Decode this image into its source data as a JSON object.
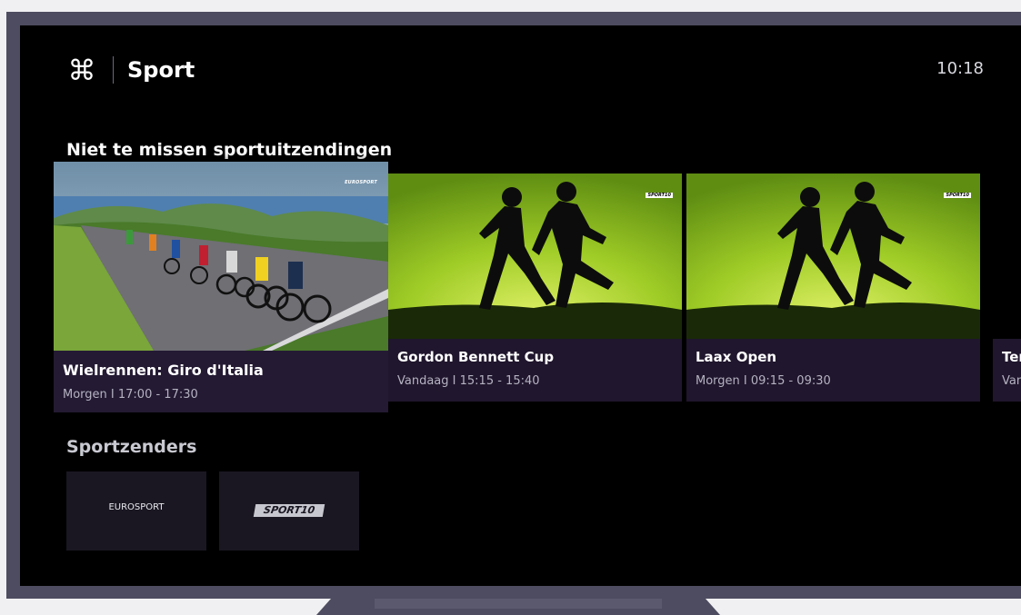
{
  "header": {
    "logo_icon": "command-key-icon",
    "title": "Sport",
    "clock": "10:18"
  },
  "sections": {
    "featured_title": "Niet te missen sportuitzendingen",
    "channels_title": "Sportzenders"
  },
  "featured": [
    {
      "title": "Wielrennen: Giro d'Italia",
      "meta": "Morgen  I  17:00 - 17:30",
      "channel_tag": "EUROSPORT",
      "focused": true
    },
    {
      "title": "Gordon Bennett Cup",
      "meta": "Vandaag  I  15:15 - 15:40",
      "channel_tag": "SPORT10"
    },
    {
      "title": "Laax Open",
      "meta": "Morgen  I  09:15 - 09:30",
      "channel_tag": "SPORT10"
    },
    {
      "title": "Ter",
      "meta": "Van"
    }
  ],
  "channels": [
    {
      "label": "EUROSPORT"
    },
    {
      "label": "SPORT10"
    }
  ],
  "colors": {
    "screen_bg": "#000000",
    "card_info_bg": "#20162d",
    "accent_green": "#8fc21a",
    "tv_frame": "#4d4c60"
  }
}
